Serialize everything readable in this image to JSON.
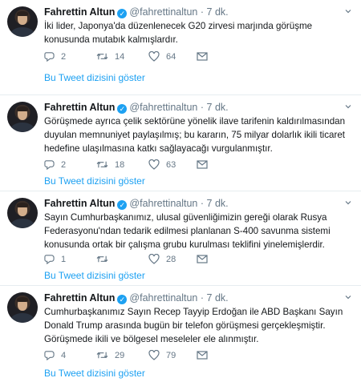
{
  "tweets": [
    {
      "name": "Fahrettin Altun",
      "handle": "@fahrettinaltun",
      "separator": "·",
      "time": "7 dk.",
      "text": "İki lider, Japonya'da düzenlenecek G20 zirvesi marjında görüşme konusunda mutabık kalmışlardır.",
      "replies": "2",
      "retweets": "14",
      "likes": "64",
      "show_thread": "Bu Tweet dizisini göster"
    },
    {
      "name": "Fahrettin Altun",
      "handle": "@fahrettinaltun",
      "separator": "·",
      "time": "7 dk.",
      "text": "Görüşmede ayrıca çelik sektörüne yönelik ilave tarifenin kaldırılmasından duyulan memnuniyet paylaşılmış; bu kararın, 75 milyar dolarlık ikili ticaret hedefine ulaşılmasına katkı sağlayacağı vurgulanmıştır.",
      "replies": "2",
      "retweets": "18",
      "likes": "63",
      "show_thread": "Bu Tweet dizisini göster"
    },
    {
      "name": "Fahrettin Altun",
      "handle": "@fahrettinaltun",
      "separator": "·",
      "time": "7 dk.",
      "text": "Sayın Cumhurbaşkanımız, ulusal güvenliğimizin gereği olarak Rusya Federasyonu'ndan tedarik edilmesi planlanan S-400 savunma sistemi konusunda ortak bir çalışma grubu kurulması teklifini yinelemişlerdir.",
      "replies": "1",
      "retweets": "",
      "likes": "28",
      "show_thread": "Bu Tweet dizisini göster"
    },
    {
      "name": "Fahrettin Altun",
      "handle": "@fahrettinaltun",
      "separator": "·",
      "time": "7 dk.",
      "text": "Cumhurbaşkanımız Sayın Recep Tayyip Erdoğan ile ABD Başkanı Sayın Donald Trump arasında bugün bir telefon görüşmesi gerçekleşmiştir. Görüşmede ikili ve bölgesel meseleler ele alınmıştır.",
      "replies": "4",
      "retweets": "29",
      "likes": "79",
      "show_thread": "Bu Tweet dizisini göster"
    }
  ],
  "icons": {
    "verified": "verified-badge-icon",
    "reply": "reply-icon",
    "retweet": "retweet-icon",
    "like": "heart-icon",
    "dm": "envelope-icon",
    "menu": "chevron-down-icon"
  },
  "colors": {
    "accent": "#1da1f2",
    "muted": "#657786",
    "text": "#14171a",
    "divider": "#e6ecf0"
  }
}
